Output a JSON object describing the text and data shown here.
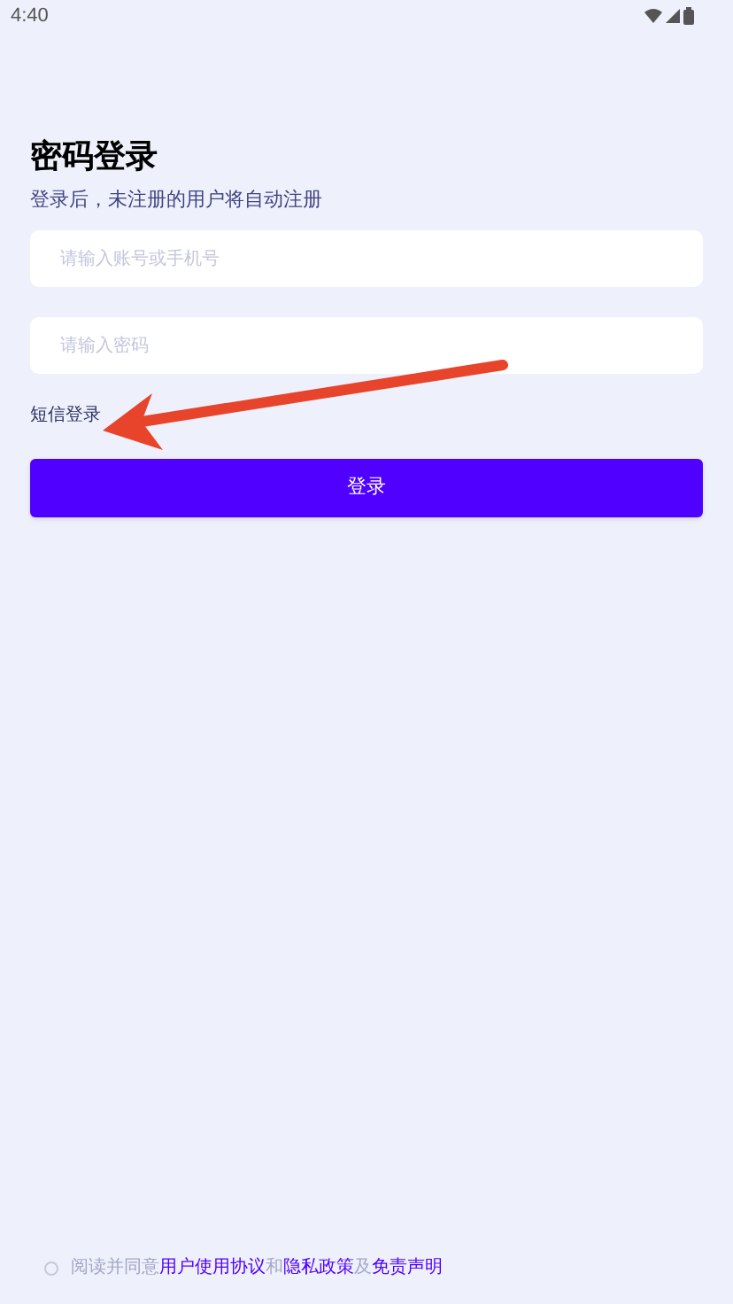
{
  "status_bar": {
    "time": "4:40"
  },
  "title": "密码登录",
  "subtitle": "登录后，未注册的用户将自动注册",
  "fields": [
    {
      "placeholder": "请输入账号或手机号"
    },
    {
      "placeholder": "请输入密码"
    }
  ],
  "sms_login_link": "短信登录",
  "login_button": "登录",
  "agreement": {
    "checked": false,
    "segments": [
      {
        "kind": "text",
        "text": "阅读并同意"
      },
      {
        "kind": "link",
        "text": "用户使用协议"
      },
      {
        "kind": "text",
        "text": "和"
      },
      {
        "kind": "link",
        "text": "隐私政策"
      },
      {
        "kind": "text",
        "text": "及"
      },
      {
        "kind": "link",
        "text": "免责声明"
      }
    ]
  }
}
